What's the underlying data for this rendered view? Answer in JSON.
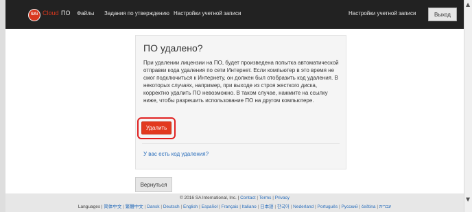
{
  "navbar": {
    "logo_mark": "SAi",
    "logo_text": "Cloud",
    "items": [
      {
        "label": "ПО"
      },
      {
        "label": "Файлы"
      },
      {
        "label": "Задания по утверждению"
      },
      {
        "label": "Настройки учетной записи"
      }
    ],
    "right_link": "Настройки учетной записи",
    "logout_label": "Выход"
  },
  "card": {
    "title": "ПО удалено?",
    "body": "При удалении лицензии на ПО, будет произведена попытка автоматической отправки кода удаления по сети Интернет. Если компьютер в это время не смог подключиться к Интернету, он должен был отобразить код удаления. В некоторых случаях, например, при выходе из строя жесткого диска, корректно удалить ПО невозможно. В таком случае, нажмите на ссылку ниже, чтобы разрешить использование ПО на другом компьютере.",
    "delete_label": "Удалить",
    "code_link": "У вас есть код удаления?"
  },
  "back_label": "Вернуться",
  "footer": {
    "copyright": "© 2016 SA International, Inc. |",
    "links": [
      "Contact",
      "Terms",
      "Privacy"
    ],
    "languages_label": "Languages |",
    "languages": [
      "简体中文",
      "繁體中文",
      "Dansk",
      "Deutsch",
      "English",
      "Español",
      "Français",
      "Italiano",
      "日本語",
      "한국어",
      "Nederland",
      "Português",
      "Русский",
      "čeština",
      "עברית"
    ]
  },
  "colors": {
    "navbar_bg": "#222222",
    "accent": "#e2391e",
    "link": "#2a6ebb",
    "highlight": "#e02020"
  },
  "icons": {
    "scroll_up": "chevron-up-icon",
    "scroll_down": "chevron-down-icon"
  }
}
